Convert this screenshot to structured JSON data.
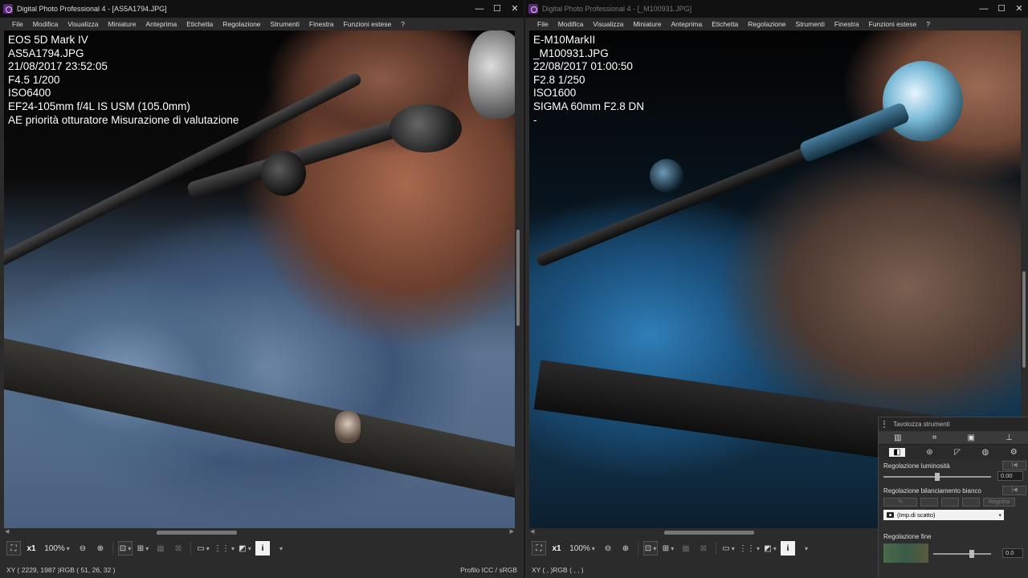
{
  "left_window": {
    "title": "Digital Photo Professional 4 - [AS5A1794.JPG]",
    "menu": [
      "File",
      "Modifica",
      "Visualizza",
      "Miniature",
      "Anteprima",
      "Etichetta",
      "Regolazione",
      "Strumenti",
      "Finestra",
      "Funzioni estese",
      "?"
    ],
    "exif": [
      "EOS 5D Mark IV",
      "AS5A1794.JPG",
      "21/08/2017 23:52:05",
      "F4.5 1/200",
      "ISO6400",
      "EF24-105mm f/4L IS USM (105.0mm)",
      "AE priorità otturatore Misurazione di valutazione"
    ],
    "toolbar": {
      "zoom_x": "x1",
      "zoom_level": "100%",
      "info": "i"
    },
    "status": {
      "coords": "XY ( 2229, 1987 )RGB (  51,  26,  32 )",
      "profile": "Profilo ICC / sRGB"
    }
  },
  "right_window": {
    "title": "Digital Photo Professional 4 - [_M100931.JPG]",
    "menu": [
      "File",
      "Modifica",
      "Visualizza",
      "Miniature",
      "Anteprima",
      "Etichetta",
      "Regolazione",
      "Strumenti",
      "Finestra",
      "Funzioni estese",
      "?"
    ],
    "exif": [
      "E-M10MarkII",
      "_M100931.JPG",
      "22/08/2017 01:00:50",
      "F2.8 1/250",
      "ISO1600",
      "SIGMA 60mm F2.8 DN",
      "-"
    ],
    "toolbar": {
      "zoom_x": "x1",
      "zoom_level": "100%",
      "info": "i"
    },
    "status": {
      "coords": "XY (       ,       )RGB (   ,   ,   )"
    }
  },
  "window_controls": {
    "minimize": "—",
    "maximize": "☐",
    "close": "✕"
  },
  "palette": {
    "title": "Tavolozza strumenti",
    "brightness_label": "Regolazione luminosità",
    "brightness_value": "0.00",
    "brightness_level": 0.5,
    "wb_label": "Regolazione bilanciamento bianco",
    "wb_register": "Registra",
    "wb_select": "(Imp.di scatto)",
    "fine_label": "Regolazione fine",
    "fine_value": "0.0"
  },
  "colors": {
    "titlebar": "#111111",
    "window_bg": "#2b2b2b",
    "palette_bg": "#2e2e2e"
  }
}
